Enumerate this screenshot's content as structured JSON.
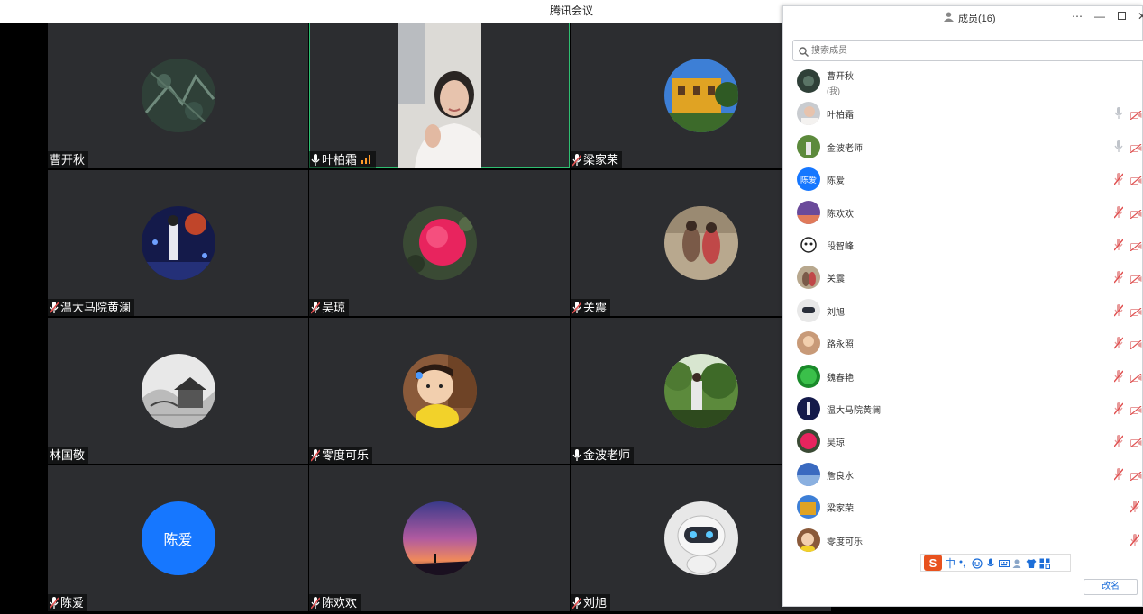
{
  "window": {
    "title": "腾讯会议"
  },
  "grid": {
    "tiles": [
      {
        "name": "曹开秋",
        "mic": "none"
      },
      {
        "name": "叶柏霜",
        "mic": "on"
      },
      {
        "name": "梁家荣",
        "mic": "muted"
      },
      {
        "name": "温大马院黄澜",
        "mic": "muted"
      },
      {
        "name": "吴琼",
        "mic": "muted"
      },
      {
        "name": "关震",
        "mic": "muted"
      },
      {
        "name": "林国敬",
        "mic": "none"
      },
      {
        "name": "零度可乐",
        "mic": "muted"
      },
      {
        "name": "金波老师",
        "mic": "on"
      },
      {
        "name": "陈爱",
        "mic": "muted",
        "avatar_text": "陈爱"
      },
      {
        "name": "陈欢欢",
        "mic": "muted"
      },
      {
        "name": "刘旭",
        "mic": "muted"
      }
    ]
  },
  "panel": {
    "title": "成员(16)",
    "search_placeholder": "搜索成员",
    "members": [
      {
        "name": "曹开秋",
        "sub": "(我)"
      },
      {
        "name": "叶柏霜",
        "mic": "on",
        "cam": "off"
      },
      {
        "name": "金波老师",
        "mic": "on",
        "cam": "off"
      },
      {
        "name": "陈爱",
        "mic": "muted",
        "cam": "off",
        "avatar_text": "陈爱"
      },
      {
        "name": "陈欢欢",
        "mic": "muted",
        "cam": "off"
      },
      {
        "name": "段智峰",
        "mic": "muted",
        "cam": "off"
      },
      {
        "name": "关震",
        "mic": "muted",
        "cam": "off"
      },
      {
        "name": "刘旭",
        "mic": "muted",
        "cam": "off"
      },
      {
        "name": "路永照",
        "mic": "muted",
        "cam": "off"
      },
      {
        "name": "魏春艳",
        "mic": "muted",
        "cam": "off"
      },
      {
        "name": "温大马院黄澜",
        "mic": "muted",
        "cam": "off"
      },
      {
        "name": "吴琼",
        "mic": "muted",
        "cam": "off"
      },
      {
        "name": "詹良水",
        "mic": "muted",
        "cam": "off"
      },
      {
        "name": "梁家荣",
        "mic": "muted"
      },
      {
        "name": "零度可乐",
        "mic": "muted"
      }
    ],
    "ime_label": "中",
    "rename_button": "改名"
  },
  "colors": {
    "accent": "#1677ff",
    "active_border": "#2fbf71",
    "tile_bg": "#2c2d30",
    "muted_red": "#e05050"
  }
}
